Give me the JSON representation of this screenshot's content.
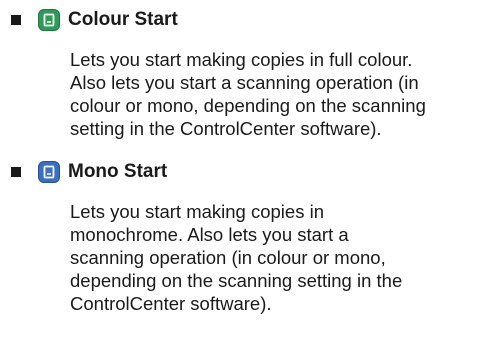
{
  "items": [
    {
      "title": "Colour Start",
      "icon": "colour-start-key-icon",
      "icon_color": "#2e9a57",
      "description_lines": [
        "Lets you start making copies in full colour.",
        "Also lets you start a scanning operation (in",
        "colour or mono, depending on the scanning",
        "setting in the ControlCenter software)."
      ]
    },
    {
      "title": "Mono Start",
      "icon": "mono-start-key-icon",
      "icon_color": "#3b6fc4",
      "description_lines": [
        "Lets you start making copies in",
        "monochrome. Also lets you start a",
        "scanning operation (in colour or mono,",
        "depending on the scanning setting in the",
        "ControlCenter software)."
      ]
    }
  ]
}
